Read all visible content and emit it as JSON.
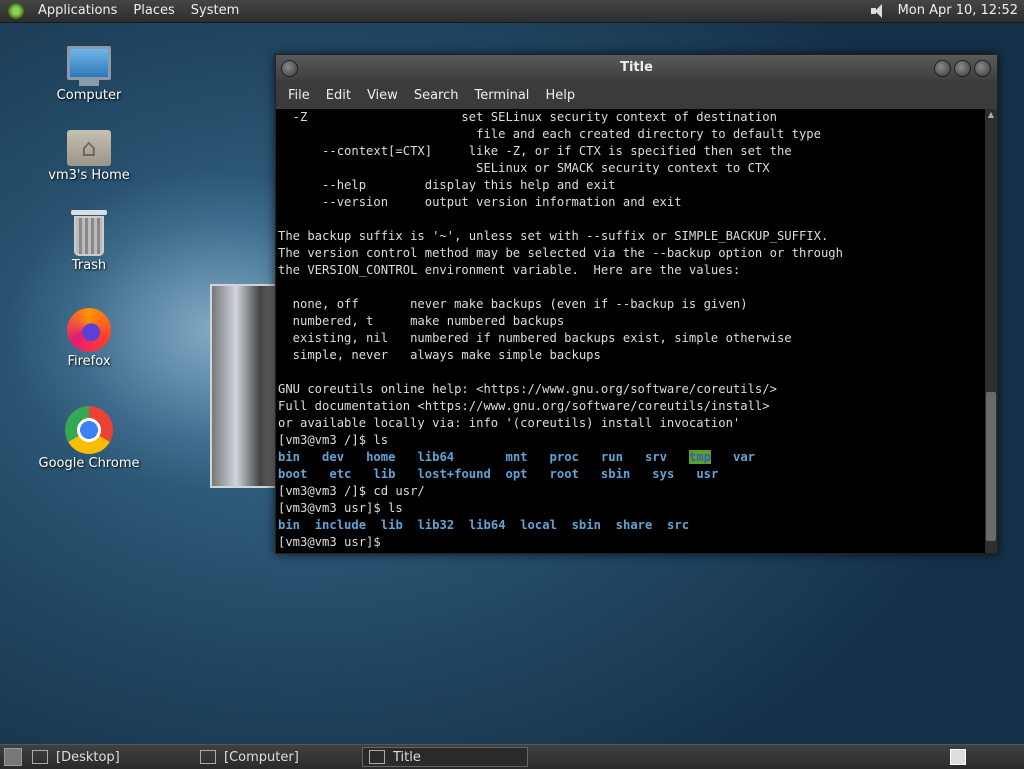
{
  "top_panel": {
    "menus": [
      "Applications",
      "Places",
      "System"
    ],
    "clock": "Mon Apr 10, 12:52"
  },
  "desktop_icons": [
    {
      "label": "Computer",
      "icon": "computer-icon"
    },
    {
      "label": "vm3's Home",
      "icon": "home-folder-icon"
    },
    {
      "label": "Trash",
      "icon": "trash-icon"
    },
    {
      "label": "Firefox",
      "icon": "firefox-icon"
    },
    {
      "label": "Google Chrome",
      "icon": "chrome-icon"
    }
  ],
  "window": {
    "title": "Title",
    "menu": [
      "File",
      "Edit",
      "View",
      "Search",
      "Terminal",
      "Help"
    ]
  },
  "terminal": {
    "lines": [
      "  -Z                     set SELinux security context of destination",
      "                           file and each created directory to default type",
      "      --context[=CTX]     like -Z, or if CTX is specified then set the",
      "                           SELinux or SMACK security context to CTX",
      "      --help        display this help and exit",
      "      --version     output version information and exit",
      "",
      "The backup suffix is '~', unless set with --suffix or SIMPLE_BACKUP_SUFFIX.",
      "The version control method may be selected via the --backup option or through",
      "the VERSION_CONTROL environment variable.  Here are the values:",
      "",
      "  none, off       never make backups (even if --backup is given)",
      "  numbered, t     make numbered backups",
      "  existing, nil   numbered if numbered backups exist, simple otherwise",
      "  simple, never   always make simple backups",
      "",
      "GNU coreutils online help: <https://www.gnu.org/software/coreutils/>",
      "Full documentation <https://www.gnu.org/software/coreutils/install>",
      "or available locally via: info '(coreutils) install invocation'",
      "[vm3@vm3 /]$ ls"
    ],
    "ls_root_row1": [
      "bin",
      "dev",
      "home",
      "lib64",
      "mnt",
      "proc",
      "run",
      "srv",
      "tmp",
      "var"
    ],
    "ls_root_row2": [
      "boot",
      "etc",
      "lib",
      "lost+found",
      "opt",
      "root",
      "sbin",
      "sys",
      "usr"
    ],
    "cmd_cd": "[vm3@vm3 /]$ cd usr/",
    "cmd_ls2": "[vm3@vm3 usr]$ ls",
    "ls_usr": [
      "bin",
      "include",
      "lib",
      "lib32",
      "lib64",
      "local",
      "sbin",
      "share",
      "src"
    ],
    "prompt": "[vm3@vm3 usr]$"
  },
  "taskbar": {
    "items": [
      {
        "label": "[Desktop]",
        "active": false
      },
      {
        "label": "[Computer]",
        "active": false
      },
      {
        "label": "Title",
        "active": true
      }
    ]
  }
}
